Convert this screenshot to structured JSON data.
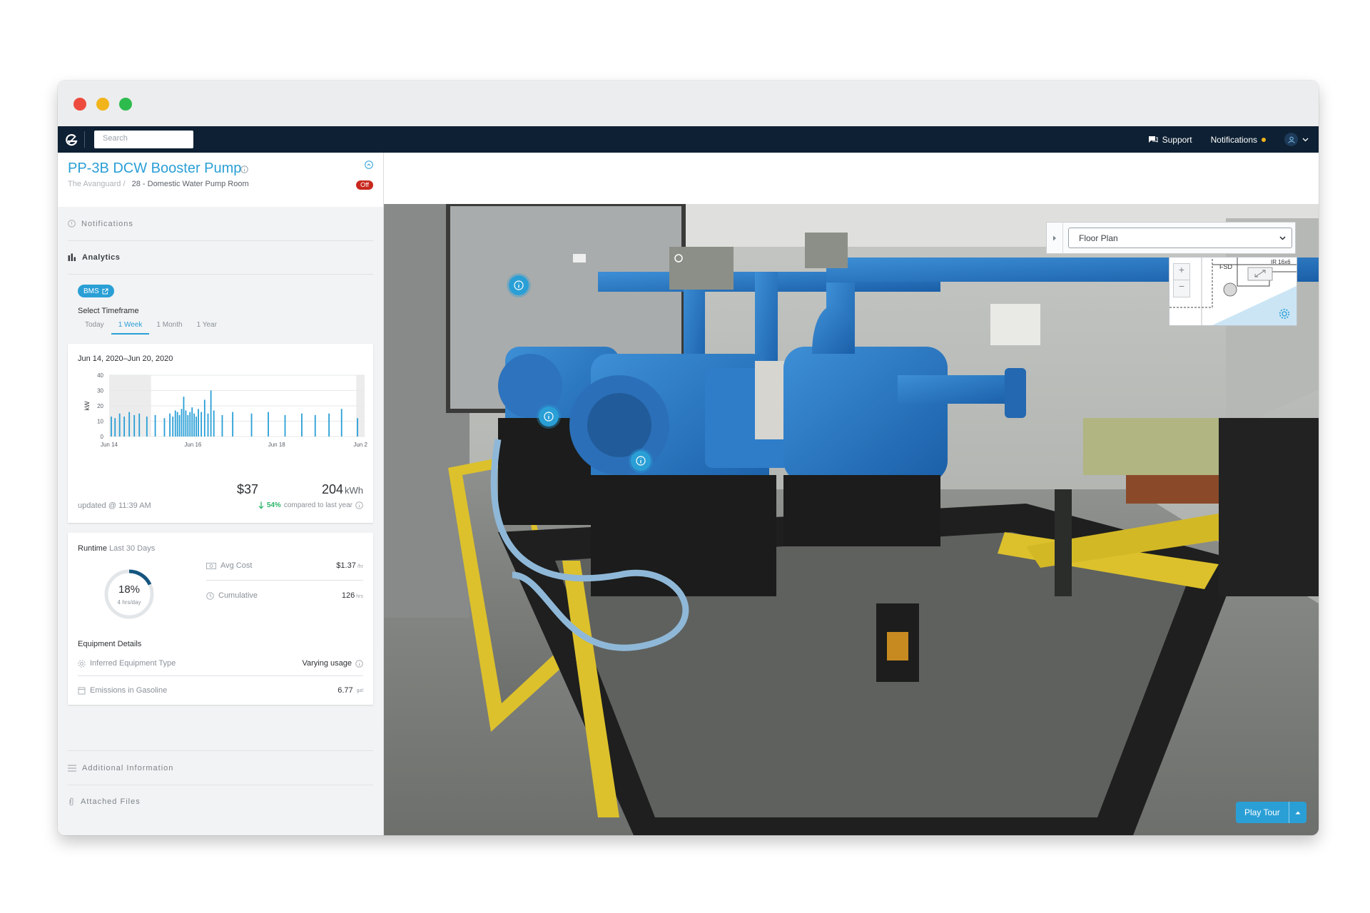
{
  "navbar": {
    "search_placeholder": "Search",
    "support_label": "Support",
    "notifications_label": "Notifications"
  },
  "asset": {
    "title": "PP-3B DCW Booster Pump",
    "breadcrumb_site": "The Avanguard",
    "breadcrumb_sep": "/",
    "breadcrumb_room": "28 - Domestic Water Pump Room",
    "status": "Off"
  },
  "sections": {
    "notifications": "Notifications",
    "analytics": "Analytics",
    "additional_info": "Additional Information",
    "attached_files": "Attached Files"
  },
  "analytics": {
    "bms_label": "BMS",
    "timeframe_label": "Select Timeframe",
    "timeframe_tabs": [
      "Today",
      "1 Week",
      "1 Month",
      "1 Year"
    ],
    "timeframe_selected": "1 Week"
  },
  "energy_card": {
    "date_range": "Jun 14, 2020–Jun 20, 2020",
    "cost": "$37",
    "energy_value": "204",
    "energy_unit": "kWh",
    "updated": "updated @ 11:39 AM",
    "change_pct": "54%",
    "change_text": "compared to last year"
  },
  "chart_data": {
    "type": "bar",
    "ylabel": "kW",
    "ylim": [
      0,
      40
    ],
    "yticks": [
      0,
      10,
      20,
      30,
      40
    ],
    "xticks": [
      "Jun 14",
      "Jun 16",
      "Jun 18",
      "Jun 2"
    ],
    "x_range_days": [
      0,
      6.1
    ],
    "shaded_ranges": [
      [
        0,
        1.0
      ],
      [
        5.9,
        6.1
      ]
    ],
    "bar_color": "#2a9fd6",
    "bars": [
      {
        "day": 0.05,
        "v": 13
      },
      {
        "day": 0.14,
        "v": 12
      },
      {
        "day": 0.25,
        "v": 15
      },
      {
        "day": 0.36,
        "v": 13
      },
      {
        "day": 0.48,
        "v": 16
      },
      {
        "day": 0.6,
        "v": 14
      },
      {
        "day": 0.72,
        "v": 15
      },
      {
        "day": 0.9,
        "v": 13
      },
      {
        "day": 1.1,
        "v": 14
      },
      {
        "day": 1.32,
        "v": 12
      },
      {
        "day": 1.45,
        "v": 15
      },
      {
        "day": 1.52,
        "v": 13
      },
      {
        "day": 1.58,
        "v": 17
      },
      {
        "day": 1.63,
        "v": 16
      },
      {
        "day": 1.68,
        "v": 14
      },
      {
        "day": 1.73,
        "v": 18
      },
      {
        "day": 1.78,
        "v": 26
      },
      {
        "day": 1.83,
        "v": 17
      },
      {
        "day": 1.88,
        "v": 14
      },
      {
        "day": 1.93,
        "v": 16
      },
      {
        "day": 1.98,
        "v": 19
      },
      {
        "day": 2.03,
        "v": 15
      },
      {
        "day": 2.08,
        "v": 13
      },
      {
        "day": 2.13,
        "v": 18
      },
      {
        "day": 2.2,
        "v": 16
      },
      {
        "day": 2.28,
        "v": 24
      },
      {
        "day": 2.36,
        "v": 15
      },
      {
        "day": 2.43,
        "v": 30
      },
      {
        "day": 2.5,
        "v": 17
      },
      {
        "day": 2.7,
        "v": 14
      },
      {
        "day": 2.95,
        "v": 16
      },
      {
        "day": 3.4,
        "v": 15
      },
      {
        "day": 3.8,
        "v": 16
      },
      {
        "day": 4.2,
        "v": 14
      },
      {
        "day": 4.6,
        "v": 15
      },
      {
        "day": 4.92,
        "v": 14
      },
      {
        "day": 5.25,
        "v": 15
      },
      {
        "day": 5.55,
        "v": 18
      },
      {
        "day": 5.93,
        "v": 12
      }
    ]
  },
  "runtime": {
    "title": "Runtime",
    "subtitle": "Last 30 Days",
    "percent": "18%",
    "percent_value": 0.18,
    "per_day": "4 hrs/day",
    "avg_cost_label": "Avg Cost",
    "avg_cost_value": "$1.37",
    "avg_cost_unit": "/hr",
    "cumulative_label": "Cumulative",
    "cumulative_value": "126",
    "cumulative_unit": "hrs"
  },
  "equipment": {
    "title": "Equipment Details",
    "type_label": "Inferred Equipment Type",
    "type_value": "Varying usage",
    "emissions_label": "Emissions in Gasoline",
    "emissions_value": "6.77",
    "emissions_unit": "gal"
  },
  "viewer": {
    "floorplan_label": "Floor Plan",
    "play_tour_label": "Play Tour",
    "minimap_text_1": "FSD",
    "minimap_text_2": "IR 16x6"
  },
  "colors": {
    "accent": "#2a9fd6",
    "navbar": "#0e2033",
    "status_off": "#c8281e",
    "positive": "#2cb56b"
  }
}
